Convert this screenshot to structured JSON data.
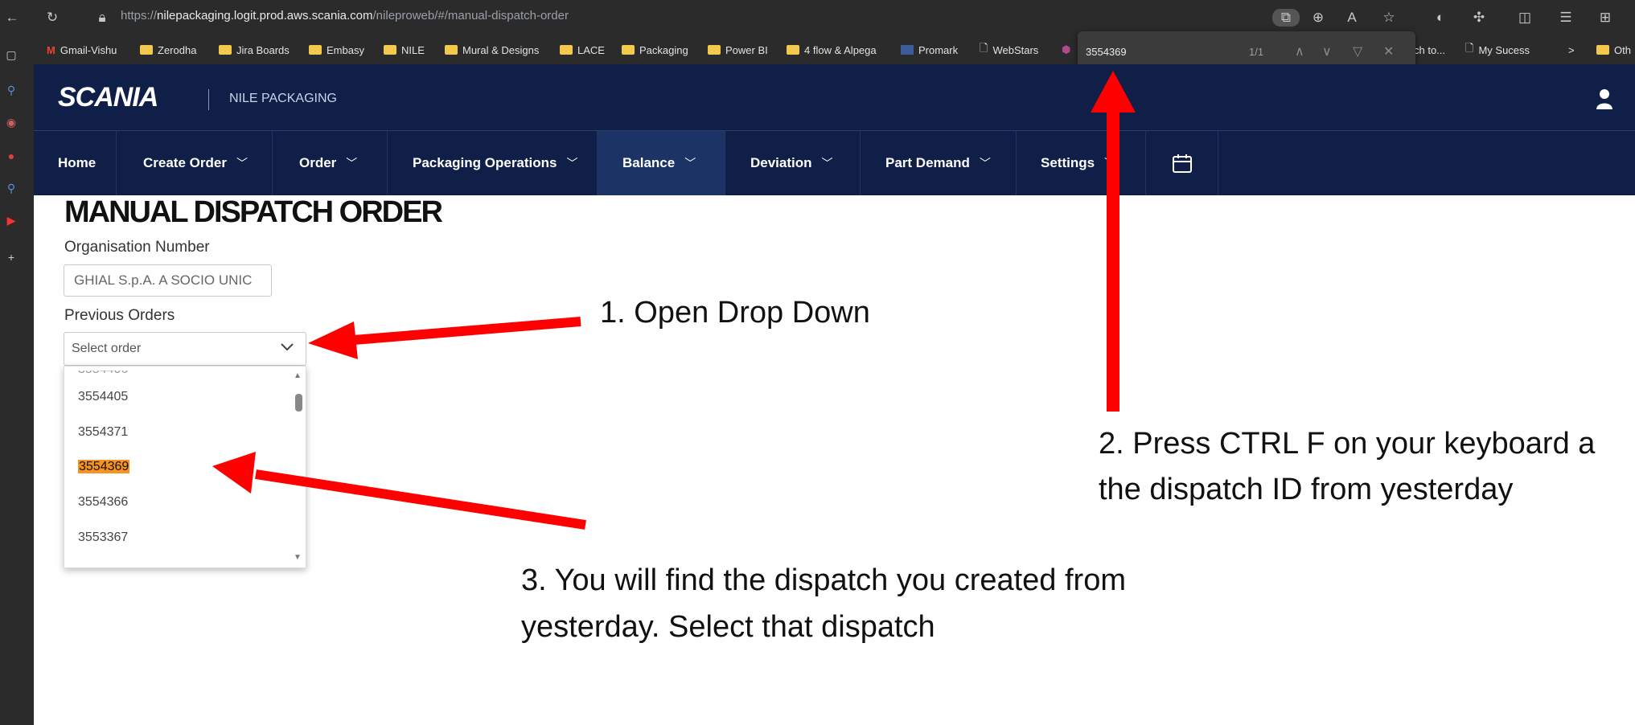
{
  "browser": {
    "url_prefix": "https://",
    "url_host": "nilepackaging.logit.prod.aws.scania.com",
    "url_path": "/nileproweb/#/manual-dispatch-order",
    "bookmarks": [
      "Gmail-Vishu",
      "Zerodha",
      "Jira Boards",
      "Embasy",
      "NILE",
      "Mural & Designs",
      "LACE",
      "Packaging",
      "Power BI",
      "4 flow & Alpega",
      "Promark",
      "WebStars",
      "ch to...",
      "My Sucess",
      "Oth"
    ],
    "bookmark_overflow": ">"
  },
  "find_bar": {
    "query": "3554369",
    "count": "1/1"
  },
  "app": {
    "logo": "SCANIA",
    "name": "NILE PACKAGING"
  },
  "nav": [
    {
      "label": "Home"
    },
    {
      "label": "Create Order"
    },
    {
      "label": "Order"
    },
    {
      "label": "Packaging Operations"
    },
    {
      "label": "Balance"
    },
    {
      "label": "Deviation"
    },
    {
      "label": "Part Demand"
    },
    {
      "label": "Settings"
    }
  ],
  "page": {
    "title": "MANUAL DISPATCH ORDER",
    "org_label": "Organisation Number",
    "org_value": "GHIAL S.p.A. A SOCIO UNIC",
    "prev_label": "Previous Orders",
    "select_placeholder": "Select order",
    "orders": [
      "3554405",
      "3554371",
      "3554369",
      "3554366",
      "3553367"
    ],
    "highlighted_order": "3554369"
  },
  "annotations": {
    "step1": "1. Open Drop Down",
    "step2_line1": "2. Press CTRL F on your keyboard a",
    "step2_line2": "the dispatch ID from yesterday",
    "step3_line1": "3. You will find the dispatch you created from",
    "step3_line2": "yesterday. Select that dispatch"
  },
  "colors": {
    "header_bg": "#0f1f47",
    "active_nav_bg": "#1c3366",
    "highlight": "#f7931e",
    "arrow": "#ff0000"
  }
}
